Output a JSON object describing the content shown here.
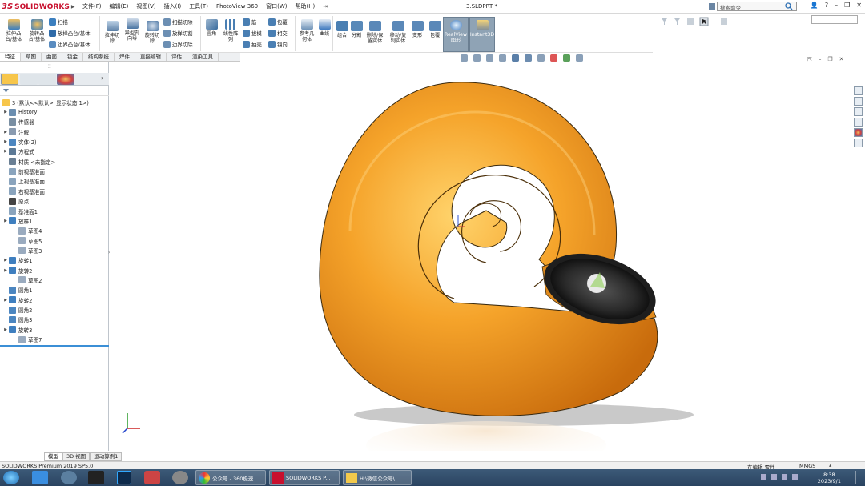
{
  "app": {
    "logo_ds": "3S",
    "logo_text": "SOLIDWORKS",
    "document_title": "3.SLDPRT *"
  },
  "menu": [
    "文件(F)",
    "编辑(E)",
    "视图(V)",
    "插入(I)",
    "工具(T)",
    "PhotoView 360",
    "窗口(W)",
    "帮助(H)"
  ],
  "search": {
    "placeholder": "搜索命令"
  },
  "ribbon": {
    "extrude_boss": "拉伸凸\n台/基体",
    "revolve_boss": "旋转凸\n台/基体",
    "sweep": "扫描",
    "loft_boss": "放样凸台/基体",
    "boundary_boss": "边界凸台/基体",
    "extrude_cut": "拉伸切\n除",
    "hole_wizard": "异型孔\n向导",
    "revolve_cut": "旋转切\n除",
    "swept_cut": "扫描切除",
    "lofted_cut": "放样切割",
    "boundary_cut": "边界切除",
    "fillet": "圆角",
    "linear_pattern": "线性阵\n列",
    "rib": "筋",
    "draft": "拔模",
    "shell": "抽壳",
    "wrap": "包覆",
    "intersect": "相交",
    "mirror": "镜向",
    "ref_geometry": "参考几\n何体",
    "curves": "曲线",
    "combine": "组合",
    "split": "分割",
    "delete_keep_body": "删除/保\n留实体",
    "move_copy_body": "移动/复\n制实体",
    "freeform": "变形",
    "wrap2": "包覆",
    "realview": "RealView\n图形",
    "instant3d": "Instant3D"
  },
  "command_tabs": [
    "特征",
    "草图",
    "曲面",
    "钣金",
    "结构系统",
    "焊件",
    "直接编辑",
    "评估",
    "渲染工具"
  ],
  "tree": {
    "root": "3 (默认<<默认>_显示状态 1>)",
    "items": [
      {
        "label": "History",
        "indent": 0,
        "arrow": true,
        "color": "#6b8eb0"
      },
      {
        "label": "传感器",
        "indent": 0,
        "arrow": false,
        "color": "#7a8fa3"
      },
      {
        "label": "注解",
        "indent": 0,
        "arrow": true,
        "color": "#8a9bb0"
      },
      {
        "label": "实体(2)",
        "indent": 0,
        "arrow": true,
        "color": "#4c86c0"
      },
      {
        "label": "方程式",
        "indent": 0,
        "arrow": true,
        "color": "#5d7a96"
      },
      {
        "label": "材质 <未指定>",
        "indent": 0,
        "arrow": false,
        "color": "#6a7f94"
      },
      {
        "label": "前视基准面",
        "indent": 0,
        "arrow": false,
        "color": "#8aa4bd"
      },
      {
        "label": "上视基准面",
        "indent": 0,
        "arrow": false,
        "color": "#8aa4bd"
      },
      {
        "label": "右视基准面",
        "indent": 0,
        "arrow": false,
        "color": "#8aa4bd"
      },
      {
        "label": "原点",
        "indent": 0,
        "arrow": false,
        "color": "#444444"
      },
      {
        "label": "基准面1",
        "indent": 0,
        "arrow": false,
        "color": "#8aa4bd"
      },
      {
        "label": "放样1",
        "indent": 0,
        "arrow": true,
        "color": "#3f7fbf"
      },
      {
        "label": "草图4",
        "indent": 1,
        "arrow": false,
        "color": "#9aabbf"
      },
      {
        "label": "草图5",
        "indent": 1,
        "arrow": false,
        "color": "#9aabbf"
      },
      {
        "label": "草图3",
        "indent": 1,
        "arrow": false,
        "color": "#9aabbf"
      },
      {
        "label": "旋转1",
        "indent": 0,
        "arrow": true,
        "color": "#3f7fbf"
      },
      {
        "label": "旋转2",
        "indent": 0,
        "arrow": true,
        "color": "#3f7fbf"
      },
      {
        "label": "草图2",
        "indent": 1,
        "arrow": false,
        "color": "#9aabbf"
      },
      {
        "label": "圆角1",
        "indent": 0,
        "arrow": false,
        "color": "#4c86c0"
      },
      {
        "label": "旋转2",
        "indent": 0,
        "arrow": true,
        "color": "#3f7fbf"
      },
      {
        "label": "圆角2",
        "indent": 0,
        "arrow": false,
        "color": "#4c86c0"
      },
      {
        "label": "圆角3",
        "indent": 0,
        "arrow": false,
        "color": "#4c86c0"
      },
      {
        "label": "旋转3",
        "indent": 0,
        "arrow": true,
        "color": "#3f7fbf"
      },
      {
        "label": "草图7",
        "indent": 1,
        "arrow": false,
        "color": "#9aabbf"
      }
    ]
  },
  "bottom_tabs": [
    "模型",
    "3D 视图",
    "运动算例1"
  ],
  "status": {
    "left": "SOLIDWORKS Premium 2019 SP5.0",
    "editing": "在编辑 零件",
    "units": "MMGS"
  },
  "taskbar": {
    "windows": [
      "公众号 - 360极速...",
      "SOLIDWORKS P...",
      "H:\\微信公众号\\..."
    ],
    "time": "8:38",
    "date": "2023/9/1"
  },
  "colors": {
    "shell_orange": "#f0a030",
    "accent_red": "#c8102e",
    "tree_highlight": "#3b8fd6"
  }
}
